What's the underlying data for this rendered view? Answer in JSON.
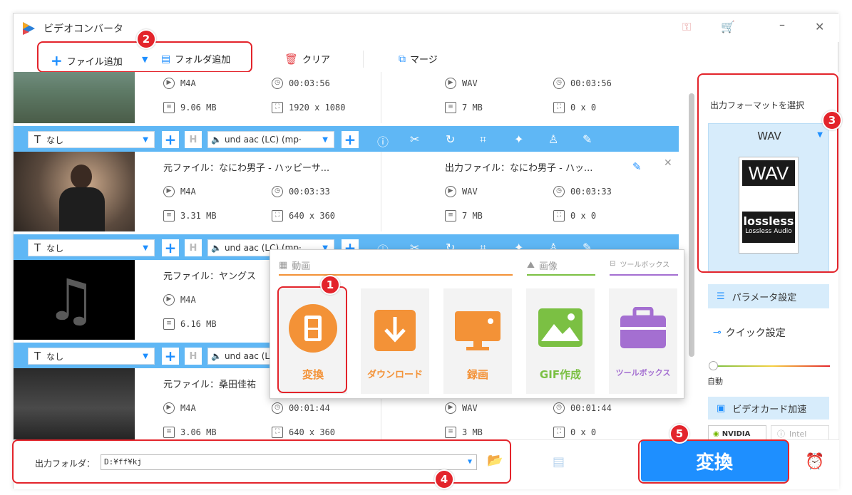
{
  "app": {
    "title": "ビデオコンバータ"
  },
  "toolbar": {
    "add_file": "ファイル追加",
    "add_folder": "フォルダ追加",
    "clear": "クリア",
    "merge": "マージ"
  },
  "editbar": {
    "subtitle": "なし",
    "audio": "und aac (LC) (mp·"
  },
  "files": [
    {
      "source_label": "",
      "source_name": "",
      "format": "M4A",
      "duration": "00:03:56",
      "size": "9.06 MB",
      "resolution": "1920 x 1080",
      "out_format": "WAV",
      "out_duration": "00:03:56",
      "out_size": "7 MB",
      "out_resolution": "0 x 0"
    },
    {
      "source_label": "元ファイル：",
      "source_name": "なにわ男子 - ハッピーサ...",
      "out_label": "出力ファイル：",
      "out_name": "なにわ男子 - ハッ...",
      "format": "M4A",
      "duration": "00:03:33",
      "size": "3.31 MB",
      "resolution": "640 x 360",
      "out_format": "WAV",
      "out_duration": "00:03:33",
      "out_size": "7 MB",
      "out_resolution": "0 x 0"
    },
    {
      "source_label": "元ファイル：",
      "source_name": "ヤングス",
      "format": "M4A",
      "duration": "",
      "size": "6.16 MB",
      "resolution": ""
    },
    {
      "source_label": "元ファイル：",
      "source_name": "桑田佳祐",
      "format": "M4A",
      "duration": "00:01:44",
      "size": "3.06 MB",
      "resolution": "640 x 360",
      "out_format": "WAV",
      "out_duration": "00:01:44",
      "out_size": "3 MB",
      "out_resolution": "0 x 0"
    }
  ],
  "popup": {
    "section_video": "動画",
    "section_image": "画像",
    "section_toolbox": "ツールボックス",
    "tiles": [
      "変換",
      "ダウンロード",
      "録画",
      "GIF作成",
      "ツールボックス"
    ]
  },
  "side": {
    "title": "出力フォーマットを選択",
    "format": "WAV",
    "card_top": "WAV",
    "card_logo": "lossless",
    "card_sub": "Lossless Audio",
    "param": "パラメータ設定",
    "quick": "クイック設定",
    "auto": "自動",
    "gpu": "ビデオカード加速",
    "nvidia": "NVIDIA",
    "intel": "Intel"
  },
  "bottom": {
    "label": "出力フォルダ：",
    "path": "D:¥ff¥kj",
    "convert": "変換"
  },
  "badges": [
    "1",
    "2",
    "3",
    "4",
    "5"
  ],
  "colors": {
    "accent": "#1e8fff",
    "orange": "#f39237",
    "red": "#e3242b",
    "green": "#7bc043",
    "purple": "#a46fd1"
  }
}
